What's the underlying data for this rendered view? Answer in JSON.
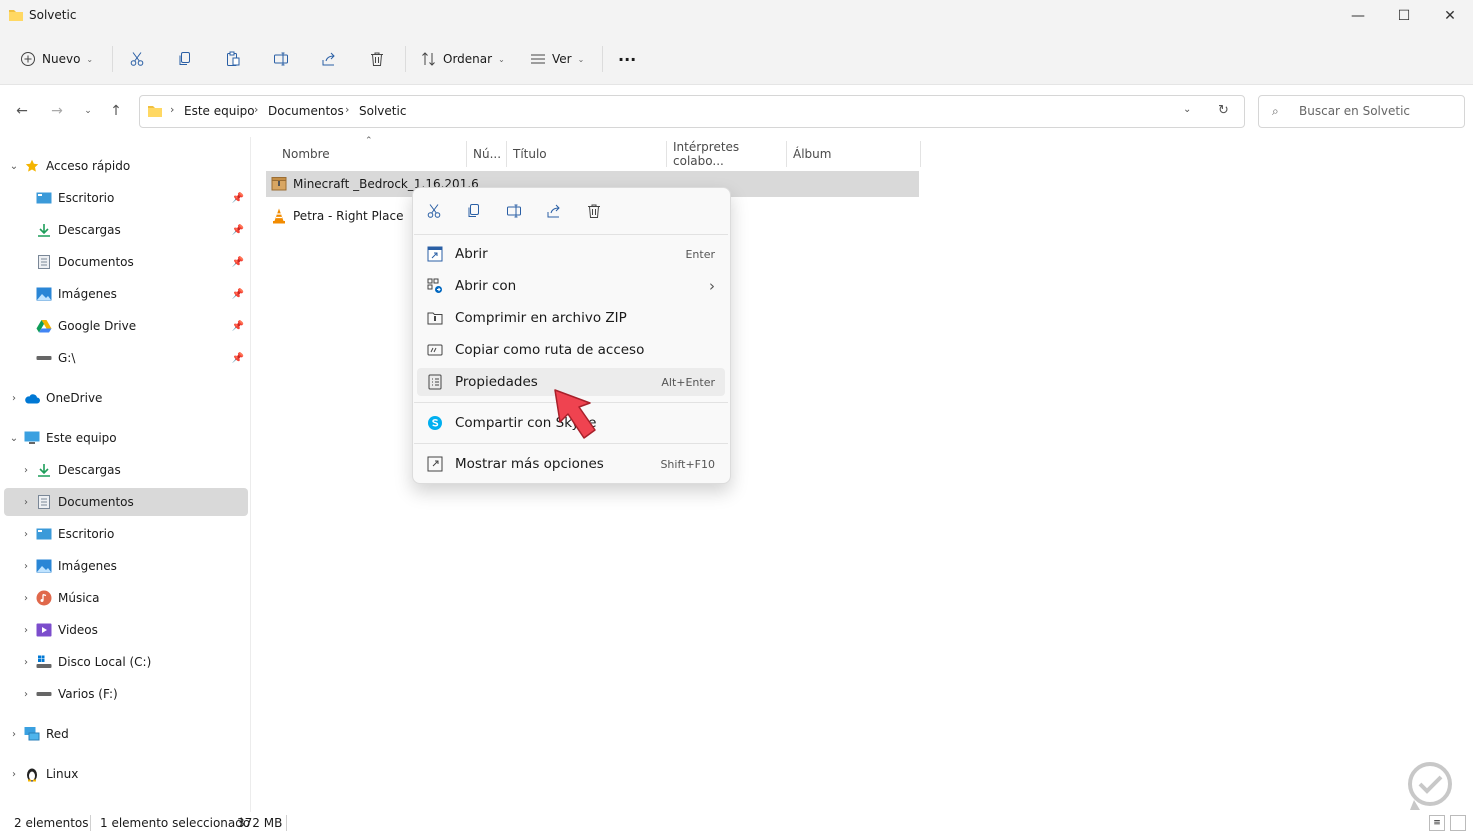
{
  "window": {
    "title": "Solvetic",
    "min": "—",
    "max": "☐",
    "close": "✕"
  },
  "toolbar": {
    "new_label": "Nuevo",
    "sort_label": "Ordenar",
    "view_label": "Ver",
    "more": "···"
  },
  "address": {
    "crumbs": [
      "Este equipo",
      "Documentos",
      "Solvetic"
    ],
    "search_placeholder": "Buscar en Solvetic"
  },
  "sidebar": {
    "quick_access": "Acceso rápido",
    "quick_items": [
      "Escritorio",
      "Descargas",
      "Documentos",
      "Imágenes",
      "Google Drive",
      "G:\\"
    ],
    "onedrive": "OneDrive",
    "this_pc": "Este equipo",
    "pc_items": [
      "Descargas",
      "Documentos",
      "Escritorio",
      "Imágenes",
      "Música",
      "Videos",
      "Disco Local (C:)",
      "Varios (F:)"
    ],
    "network": "Red",
    "linux": "Linux"
  },
  "columns": [
    "Nombre",
    "Nú...",
    "Título",
    "Intérpretes colabo...",
    "Álbum"
  ],
  "files": [
    {
      "name": "Minecraft _Bedrock_1.16.201.6"
    },
    {
      "name": "Petra - Right Place"
    }
  ],
  "context_menu": {
    "items": [
      {
        "label": "Abrir",
        "shortcut": "Enter"
      },
      {
        "label": "Abrir con",
        "shortcut": "›"
      },
      {
        "label": "Comprimir en archivo ZIP",
        "shortcut": ""
      },
      {
        "label": "Copiar como ruta de acceso",
        "shortcut": ""
      },
      {
        "label": "Propiedades",
        "shortcut": "Alt+Enter"
      },
      {
        "label": "Compartir con Skype",
        "shortcut": ""
      },
      {
        "label": "Mostrar más opciones",
        "shortcut": "Shift+F10"
      }
    ]
  },
  "status": {
    "count": "2 elementos",
    "selection": "1 elemento seleccionado",
    "size": "372 MB"
  },
  "colors": {
    "accent": "#0067c0",
    "folder": "#f0c040",
    "arrow": "#ef4350"
  }
}
